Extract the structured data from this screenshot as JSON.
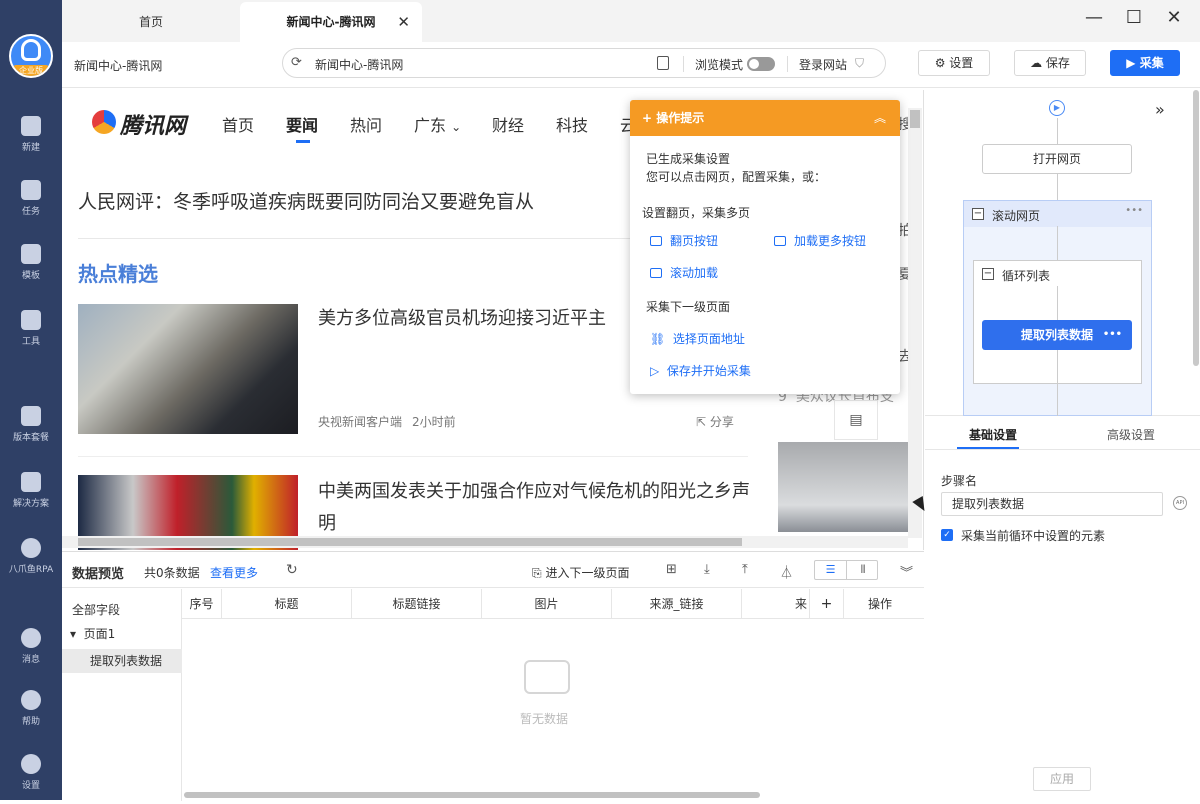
{
  "sidebar": {
    "logo_badge": "企业版",
    "items": [
      {
        "label": "新建",
        "icon": "plus-square-icon"
      },
      {
        "label": "任务",
        "icon": "checklist-icon"
      },
      {
        "label": "模板",
        "icon": "template-icon"
      },
      {
        "label": "工具",
        "icon": "toolbox-icon"
      },
      {
        "label": "版本套餐",
        "icon": "crown-icon"
      },
      {
        "label": "解决方案",
        "icon": "solution-icon"
      },
      {
        "label": "八爪鱼RPA",
        "icon": "octopus-icon"
      },
      {
        "label": "消息",
        "icon": "bell-icon"
      },
      {
        "label": "帮助",
        "icon": "help-icon"
      },
      {
        "label": "设置",
        "icon": "gear-icon"
      }
    ]
  },
  "tabs": [
    {
      "label": "首页"
    },
    {
      "label": "新闻中心-腾讯网",
      "close": "✕"
    }
  ],
  "window": {
    "minimize": "—",
    "maximize": "☐",
    "close": "✕"
  },
  "addr": {
    "page_title": "新闻中心-腾讯网",
    "url": "新闻中心-腾讯网",
    "browse_mode": "浏览模式",
    "login_site": "登录网站"
  },
  "toolbar": {
    "settings": "设置",
    "save": "保存",
    "collect": "采集"
  },
  "web": {
    "logo": "腾讯网",
    "nav": [
      "首页",
      "要闻",
      "热问",
      "广东",
      "财经",
      "科技",
      "云"
    ],
    "nav_dropdown": "⌄",
    "headline": "人民网评：冬季呼吸道疾病既要同防同治又要避免盲从",
    "section_title": "热点精选",
    "news": [
      {
        "title": "美方多位高级官员机场迎接习近平主",
        "source": "央视新闻客户端",
        "time": "2小时前",
        "share": "分享"
      },
      {
        "title": "中美两国发表关于加强合作应对气候危机的阳光之乡声明"
      }
    ],
    "rank_num": "9",
    "rank_text": "美众议长首布支",
    "right_chars": [
      "搜",
      "拍",
      "夏",
      "去"
    ]
  },
  "tips": {
    "title": "操作提示",
    "collapse": "︽",
    "line1": "已生成采集设置",
    "line2": "您可以点击网页，配置采集，或：",
    "sec1": "设置翻页，采集多页",
    "link_page_btn": "翻页按钮",
    "link_load_more": "加载更多按钮",
    "link_scroll": "滚动加载",
    "sec2": "采集下一级页面",
    "link_select_url": "选择页面地址",
    "link_save_start": "保存并开始采集"
  },
  "preview": {
    "title": "数据预览",
    "count": "共0条数据",
    "more": "查看更多",
    "next_level": "进入下一级页面",
    "all_fields": "全部字段",
    "page1": "页面1",
    "extract": "提取列表数据",
    "columns": [
      "序号",
      "标题",
      "标题链接",
      "图片",
      "来源_链接",
      "来",
      "+",
      "操作"
    ],
    "empty": "暂无数据"
  },
  "flow": {
    "open_page": "打开网页",
    "scroll_page": "滚动网页",
    "loop_list": "循环列表",
    "extract": "提取列表数据",
    "more": "•••"
  },
  "settings": {
    "tab_basic": "基础设置",
    "tab_advanced": "高级设置",
    "step_name_label": "步骤名",
    "step_name_value": "提取列表数据",
    "api": "API",
    "checkbox_label": "采集当前循环中设置的元素",
    "apply": "应用"
  }
}
